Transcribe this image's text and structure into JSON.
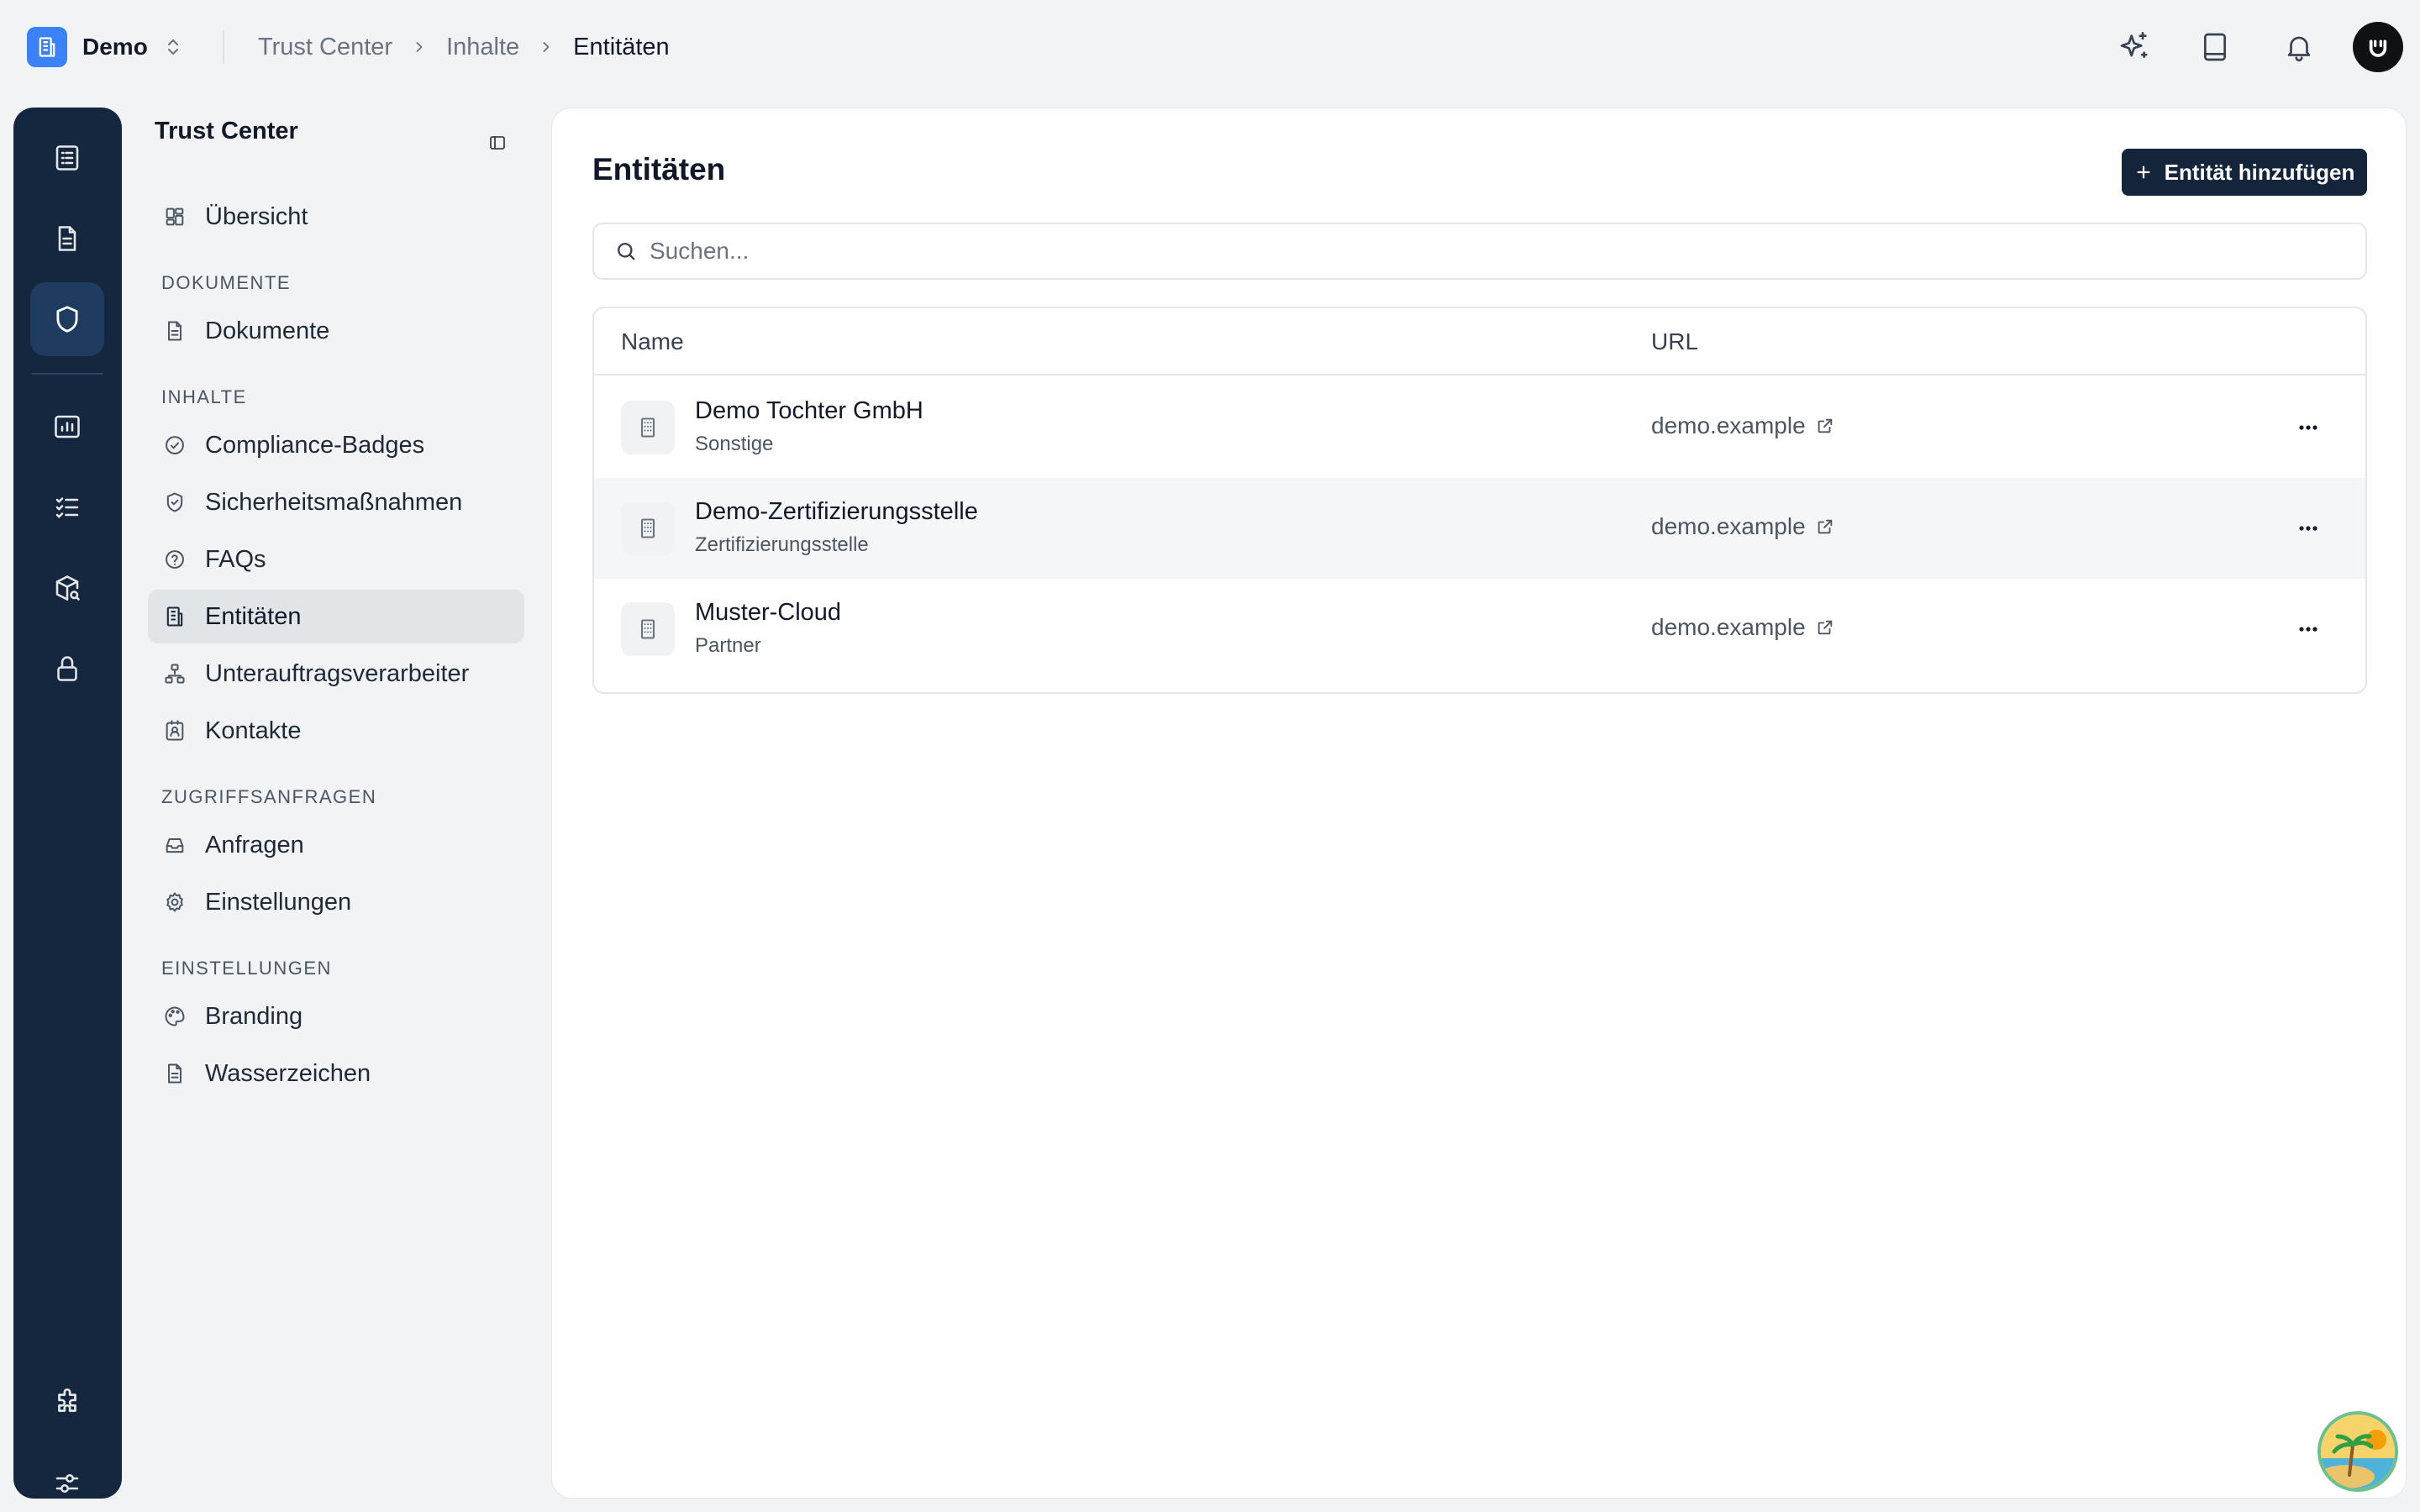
{
  "org": {
    "name": "Demo",
    "logo_icon": "building-icon",
    "accent": "#3b82f6"
  },
  "breadcrumb": [
    {
      "label": "Trust Center"
    },
    {
      "label": "Inhalte"
    },
    {
      "label": "Entitäten"
    }
  ],
  "topbar_icons": [
    "sparkles-icon",
    "book-icon",
    "bell-icon",
    "avatar"
  ],
  "rail": {
    "background": "#15273f",
    "items": [
      {
        "icon": "checklist-icon"
      },
      {
        "icon": "document-icon"
      },
      {
        "icon": "shield-icon",
        "active": true
      },
      {
        "icon": "report-icon"
      },
      {
        "icon": "tasks-icon"
      },
      {
        "icon": "package-search-icon"
      },
      {
        "icon": "lock-icon"
      },
      {
        "icon": "puzzle-icon"
      },
      {
        "icon": "sliders-icon"
      }
    ]
  },
  "sidenav": {
    "title": "Trust Center",
    "overview": "Übersicht",
    "sections": {
      "documents": "DOKUMENTE",
      "contents": "INHALTE",
      "access": "ZUGRIFFSANFRAGEN",
      "settings": "EINSTELLUNGEN"
    },
    "items": {
      "documents": "Dokumente",
      "badges": "Compliance-Badges",
      "measures": "Sicherheitsmaßnahmen",
      "faqs": "FAQs",
      "entities": "Entitäten",
      "subprocessors": "Unterauftragsverarbeiter",
      "contacts": "Kontakte",
      "requests": "Anfragen",
      "access_settings": "Einstellungen",
      "branding": "Branding",
      "watermark": "Wasserzeichen"
    }
  },
  "main": {
    "title": "Entitäten",
    "add_button": "Entität hinzufügen",
    "search": {
      "placeholder": "Suchen...",
      "value": ""
    },
    "table": {
      "columns": {
        "name": "Name",
        "url": "URL"
      },
      "rows": [
        {
          "name": "Demo Tochter GmbH",
          "type": "Sonstige",
          "url": "demo.example"
        },
        {
          "name": "Demo-Zertifizierungsstelle",
          "type": "Zertifizierungsstelle",
          "url": "demo.example"
        },
        {
          "name": "Muster-Cloud",
          "type": "Partner",
          "url": "demo.example"
        }
      ]
    }
  },
  "colors": {
    "primary_button": "#14243a",
    "active_nav": "#e2e5e8"
  }
}
